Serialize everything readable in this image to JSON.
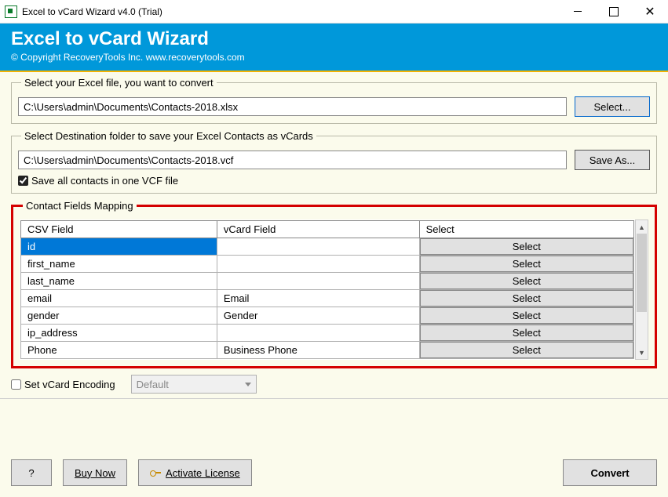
{
  "window": {
    "title": "Excel to vCard Wizard v4.0 (Trial)"
  },
  "header": {
    "title": "Excel to vCard Wizard",
    "copyright": "© Copyright RecoveryTools Inc. www.recoverytools.com"
  },
  "source": {
    "legend": "Select your Excel file, you want to convert",
    "path": "C:\\Users\\admin\\Documents\\Contacts-2018.xlsx",
    "button": "Select..."
  },
  "dest": {
    "legend": "Select Destination folder to save your Excel Contacts as vCards",
    "path": "C:\\Users\\admin\\Documents\\Contacts-2018.vcf",
    "button": "Save As...",
    "save_all_label": "Save all contacts in one VCF file",
    "save_all_checked": true
  },
  "mapping": {
    "legend": "Contact Fields Mapping",
    "columns": {
      "csv": "CSV Field",
      "vcard": "vCard Field",
      "select": "Select"
    },
    "select_label": "Select",
    "rows": [
      {
        "csv": "id",
        "vcard": "",
        "selected": true
      },
      {
        "csv": "first_name",
        "vcard": "",
        "selected": false
      },
      {
        "csv": "last_name",
        "vcard": "",
        "selected": false
      },
      {
        "csv": "email",
        "vcard": "Email",
        "selected": false
      },
      {
        "csv": "gender",
        "vcard": "Gender",
        "selected": false
      },
      {
        "csv": "ip_address",
        "vcard": "",
        "selected": false
      },
      {
        "csv": "Phone",
        "vcard": "Business Phone",
        "selected": false
      }
    ]
  },
  "encoding": {
    "checkbox_label": "Set vCard Encoding",
    "checked": false,
    "combo_value": "Default"
  },
  "buttons": {
    "help": "?",
    "buy": "Buy Now",
    "activate": "Activate License",
    "convert": "Convert"
  }
}
